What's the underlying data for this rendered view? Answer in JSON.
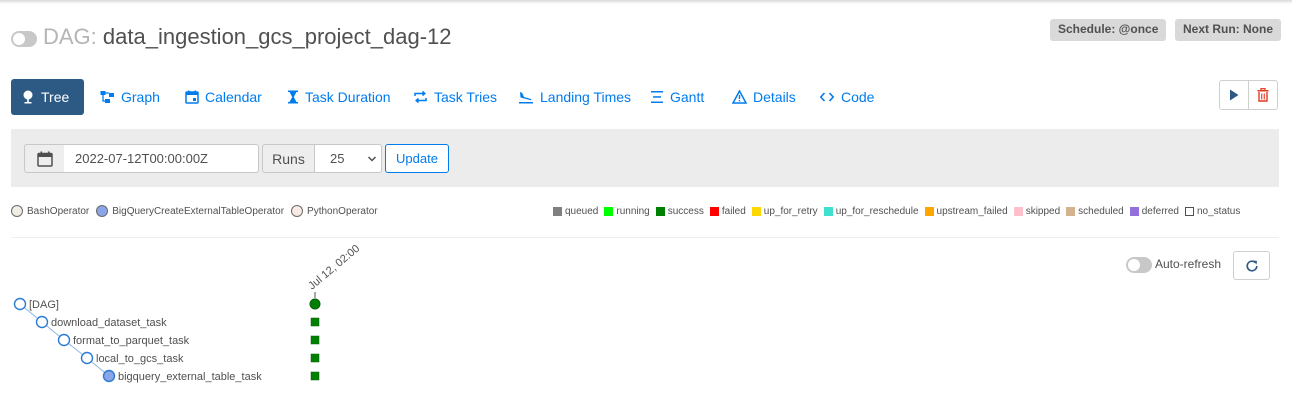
{
  "header": {
    "dag_prefix": "DAG:",
    "dag_id": "data_ingestion_gcs_project_dag-12",
    "schedule_badge": "Schedule: @once",
    "next_run_badge": "Next Run: None",
    "paused_toggle_icon": "toggle-off-icon"
  },
  "nav": {
    "tabs": [
      {
        "label": "Tree",
        "icon": "tree-icon",
        "active": true
      },
      {
        "label": "Graph",
        "icon": "graph-icon",
        "active": false
      },
      {
        "label": "Calendar",
        "icon": "calendar-icon",
        "active": false
      },
      {
        "label": "Task Duration",
        "icon": "hourglass-icon",
        "active": false
      },
      {
        "label": "Task Tries",
        "icon": "retry-icon",
        "active": false
      },
      {
        "label": "Landing Times",
        "icon": "plane-landing-icon",
        "active": false
      },
      {
        "label": "Gantt",
        "icon": "gantt-icon",
        "active": false
      },
      {
        "label": "Details",
        "icon": "warning-triangle-icon",
        "active": false
      },
      {
        "label": "Code",
        "icon": "code-icon",
        "active": false
      }
    ],
    "actions": [
      {
        "icon": "play-icon"
      },
      {
        "icon": "trash-icon"
      }
    ]
  },
  "filter": {
    "base_date_value": "2022-07-12T00:00:00Z",
    "runs_label": "Runs",
    "runs_value": "25",
    "update_label": "Update"
  },
  "operators": [
    {
      "name": "BashOperator",
      "color": "#f0ede4"
    },
    {
      "name": "BigQueryCreateExternalTableOperator",
      "color": "#8aa5e8"
    },
    {
      "name": "PythonOperator",
      "color": "#f8ebe5"
    }
  ],
  "states": [
    {
      "name": "queued",
      "color": "#808080"
    },
    {
      "name": "running",
      "color": "#00ff00"
    },
    {
      "name": "success",
      "color": "#008000"
    },
    {
      "name": "failed",
      "color": "#ff0000"
    },
    {
      "name": "up_for_retry",
      "color": "#ffd700"
    },
    {
      "name": "up_for_reschedule",
      "color": "#40e0d0"
    },
    {
      "name": "upstream_failed",
      "color": "#ffa500"
    },
    {
      "name": "skipped",
      "color": "#ffc0cb"
    },
    {
      "name": "scheduled",
      "color": "#d2b48c"
    },
    {
      "name": "deferred",
      "color": "#9370db"
    },
    {
      "name": "no_status",
      "color": "#ffffff"
    }
  ],
  "auto_refresh": {
    "label": "Auto-refresh",
    "refresh_icon": "refresh-icon"
  },
  "tree": {
    "run_label": "Jul 12, 02:00",
    "nodes": [
      {
        "label": "[DAG]",
        "state": "success"
      },
      {
        "label": "download_dataset_task",
        "state": "success"
      },
      {
        "label": "format_to_parquet_task",
        "state": "success"
      },
      {
        "label": "local_to_gcs_task",
        "state": "success"
      },
      {
        "label": "bigquery_external_table_task",
        "state": "success"
      }
    ]
  }
}
